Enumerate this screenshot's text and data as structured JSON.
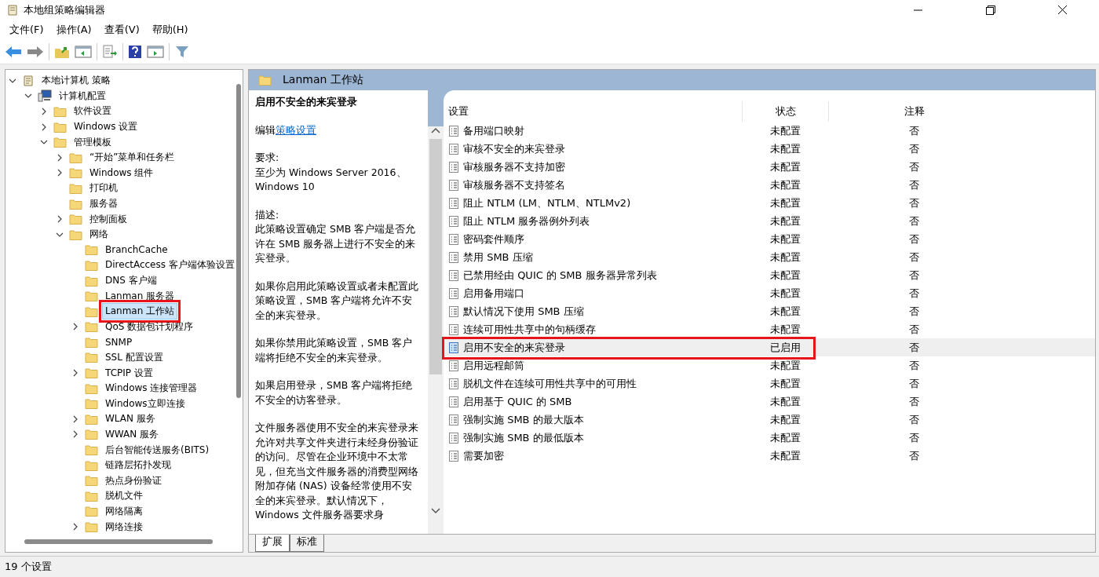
{
  "window": {
    "title": "本地组策略编辑器"
  },
  "menu": [
    "文件(F)",
    "操作(A)",
    "查看(V)",
    "帮助(H)"
  ],
  "tree": [
    {
      "label": "本地计算机 策略",
      "kind": "policy",
      "selected": false,
      "highlighted": false,
      "expanded": true,
      "children": [
        {
          "label": "计算机配置",
          "kind": "computer",
          "selected": false,
          "highlighted": false,
          "expanded": true,
          "children": [
            {
              "label": "软件设置",
              "kind": "folder",
              "selected": false,
              "highlighted": false,
              "expanded": false
            },
            {
              "label": "Windows 设置",
              "kind": "folder",
              "selected": false,
              "highlighted": false,
              "expanded": false
            },
            {
              "label": "管理模板",
              "kind": "folder",
              "selected": false,
              "highlighted": false,
              "expanded": true,
              "children": [
                {
                  "label": "“开始”菜单和任务栏",
                  "kind": "folder",
                  "selected": false,
                  "highlighted": false,
                  "expanded": false
                },
                {
                  "label": "Windows 组件",
                  "kind": "folder",
                  "selected": false,
                  "highlighted": false,
                  "expanded": false
                },
                {
                  "label": "打印机",
                  "kind": "folder",
                  "selected": false,
                  "highlighted": false
                },
                {
                  "label": "服务器",
                  "kind": "folder",
                  "selected": false,
                  "highlighted": false
                },
                {
                  "label": "控制面板",
                  "kind": "folder",
                  "selected": false,
                  "highlighted": false,
                  "expanded": false
                },
                {
                  "label": "网络",
                  "kind": "folder",
                  "selected": false,
                  "highlighted": false,
                  "expanded": true,
                  "children": [
                    {
                      "label": "BranchCache",
                      "kind": "folder",
                      "selected": false,
                      "highlighted": false
                    },
                    {
                      "label": "DirectAccess 客户端体验设置",
                      "kind": "folder",
                      "selected": false,
                      "highlighted": false
                    },
                    {
                      "label": "DNS 客户端",
                      "kind": "folder",
                      "selected": false,
                      "highlighted": false
                    },
                    {
                      "label": "Lanman 服务器",
                      "kind": "folder",
                      "selected": false,
                      "highlighted": false
                    },
                    {
                      "label": "Lanman 工作站",
                      "kind": "folder",
                      "selected": true,
                      "highlighted": true
                    },
                    {
                      "label": "QoS 数据包计划程序",
                      "kind": "folder",
                      "selected": false,
                      "highlighted": false,
                      "expanded": false
                    },
                    {
                      "label": "SNMP",
                      "kind": "folder",
                      "selected": false,
                      "highlighted": false
                    },
                    {
                      "label": "SSL 配置设置",
                      "kind": "folder",
                      "selected": false,
                      "highlighted": false
                    },
                    {
                      "label": "TCPIP 设置",
                      "kind": "folder",
                      "selected": false,
                      "highlighted": false,
                      "expanded": false
                    },
                    {
                      "label": "Windows 连接管理器",
                      "kind": "folder",
                      "selected": false,
                      "highlighted": false
                    },
                    {
                      "label": "Windows立即连接",
                      "kind": "folder",
                      "selected": false,
                      "highlighted": false
                    },
                    {
                      "label": "WLAN 服务",
                      "kind": "folder",
                      "selected": false,
                      "highlighted": false,
                      "expanded": false
                    },
                    {
                      "label": "WWAN 服务",
                      "kind": "folder",
                      "selected": false,
                      "highlighted": false,
                      "expanded": false
                    },
                    {
                      "label": "后台智能传送服务(BITS)",
                      "kind": "folder",
                      "selected": false,
                      "highlighted": false
                    },
                    {
                      "label": "链路层拓扑发现",
                      "kind": "folder",
                      "selected": false,
                      "highlighted": false
                    },
                    {
                      "label": "热点身份验证",
                      "kind": "folder",
                      "selected": false,
                      "highlighted": false
                    },
                    {
                      "label": "脱机文件",
                      "kind": "folder",
                      "selected": false,
                      "highlighted": false
                    },
                    {
                      "label": "网络隔离",
                      "kind": "folder",
                      "selected": false,
                      "highlighted": false
                    },
                    {
                      "label": "网络连接",
                      "kind": "folder",
                      "selected": false,
                      "highlighted": false,
                      "expanded": false
                    }
                  ]
                }
              ]
            }
          ]
        }
      ]
    }
  ],
  "header": {
    "title": "Lanman 工作站"
  },
  "description": [
    {
      "kind": "title",
      "text": "启用不安全的来宾登录"
    },
    {
      "kind": "link_line",
      "text": "编辑",
      "link": "策略设置"
    },
    {
      "kind": "text",
      "text": "要求:\n至少为 Windows Server 2016、Windows 10"
    },
    {
      "kind": "text",
      "text": "描述:\n此策略设置确定 SMB 客户端是否允许在 SMB 服务器上进行不安全的来宾登录。"
    },
    {
      "kind": "text",
      "text": "如果你启用此策略设置或者未配置此策略设置，SMB 客户端将允许不安全的来宾登录。"
    },
    {
      "kind": "text",
      "text": "如果你禁用此策略设置，SMB 客户端将拒绝不安全的来宾登录。"
    },
    {
      "kind": "text",
      "text": "如果启用登录，SMB 客户端将拒绝不安全的访客登录。"
    },
    {
      "kind": "text",
      "text": "文件服务器使用不安全的来宾登录来允许对共享文件夹进行未经身份验证的访问。尽管在企业环境中不太常见，但充当文件服务器的消费型网络附加存储 (NAS) 设备经常使用不安全的来宾登录。默认情况下，Windows 文件服务器要求身"
    }
  ],
  "table": {
    "columns": [
      "设置",
      "状态",
      "注释"
    ],
    "rows": [
      {
        "setting": "备用端口映射",
        "state": "未配置",
        "comment": "否",
        "selected": false,
        "highlighted": false
      },
      {
        "setting": "审核不安全的来宾登录",
        "state": "未配置",
        "comment": "否",
        "selected": false,
        "highlighted": false
      },
      {
        "setting": "审核服务器不支持加密",
        "state": "未配置",
        "comment": "否",
        "selected": false,
        "highlighted": false
      },
      {
        "setting": "审核服务器不支持签名",
        "state": "未配置",
        "comment": "否",
        "selected": false,
        "highlighted": false
      },
      {
        "setting": "阻止 NTLM (LM、NTLM、NTLMv2)",
        "state": "未配置",
        "comment": "否",
        "selected": false,
        "highlighted": false
      },
      {
        "setting": "阻止 NTLM 服务器例外列表",
        "state": "未配置",
        "comment": "否",
        "selected": false,
        "highlighted": false
      },
      {
        "setting": "密码套件顺序",
        "state": "未配置",
        "comment": "否",
        "selected": false,
        "highlighted": false
      },
      {
        "setting": "禁用 SMB 压缩",
        "state": "未配置",
        "comment": "否",
        "selected": false,
        "highlighted": false
      },
      {
        "setting": "已禁用经由 QUIC 的 SMB 服务器异常列表",
        "state": "未配置",
        "comment": "否",
        "selected": false,
        "highlighted": false
      },
      {
        "setting": "启用备用端口",
        "state": "未配置",
        "comment": "否",
        "selected": false,
        "highlighted": false
      },
      {
        "setting": "默认情况下使用 SMB 压缩",
        "state": "未配置",
        "comment": "否",
        "selected": false,
        "highlighted": false
      },
      {
        "setting": "连续可用性共享中的句柄缓存",
        "state": "未配置",
        "comment": "否",
        "selected": false,
        "highlighted": false
      },
      {
        "setting": "启用不安全的来宾登录",
        "state": "已启用",
        "comment": "否",
        "selected": true,
        "highlighted": true
      },
      {
        "setting": "启用远程邮筒",
        "state": "未配置",
        "comment": "否",
        "selected": false,
        "highlighted": false
      },
      {
        "setting": "脱机文件在连续可用性共享中的可用性",
        "state": "未配置",
        "comment": "否",
        "selected": false,
        "highlighted": false
      },
      {
        "setting": "启用基于 QUIC 的 SMB",
        "state": "未配置",
        "comment": "否",
        "selected": false,
        "highlighted": false
      },
      {
        "setting": "强制实施 SMB 的最大版本",
        "state": "未配置",
        "comment": "否",
        "selected": false,
        "highlighted": false
      },
      {
        "setting": "强制实施 SMB 的最低版本",
        "state": "未配置",
        "comment": "否",
        "selected": false,
        "highlighted": false
      },
      {
        "setting": "需要加密",
        "state": "未配置",
        "comment": "否",
        "selected": false,
        "highlighted": false
      }
    ]
  },
  "tabs": [
    {
      "label": "扩展",
      "selected": true
    },
    {
      "label": "标准",
      "selected": false
    }
  ],
  "status_bar": "19 个设置"
}
